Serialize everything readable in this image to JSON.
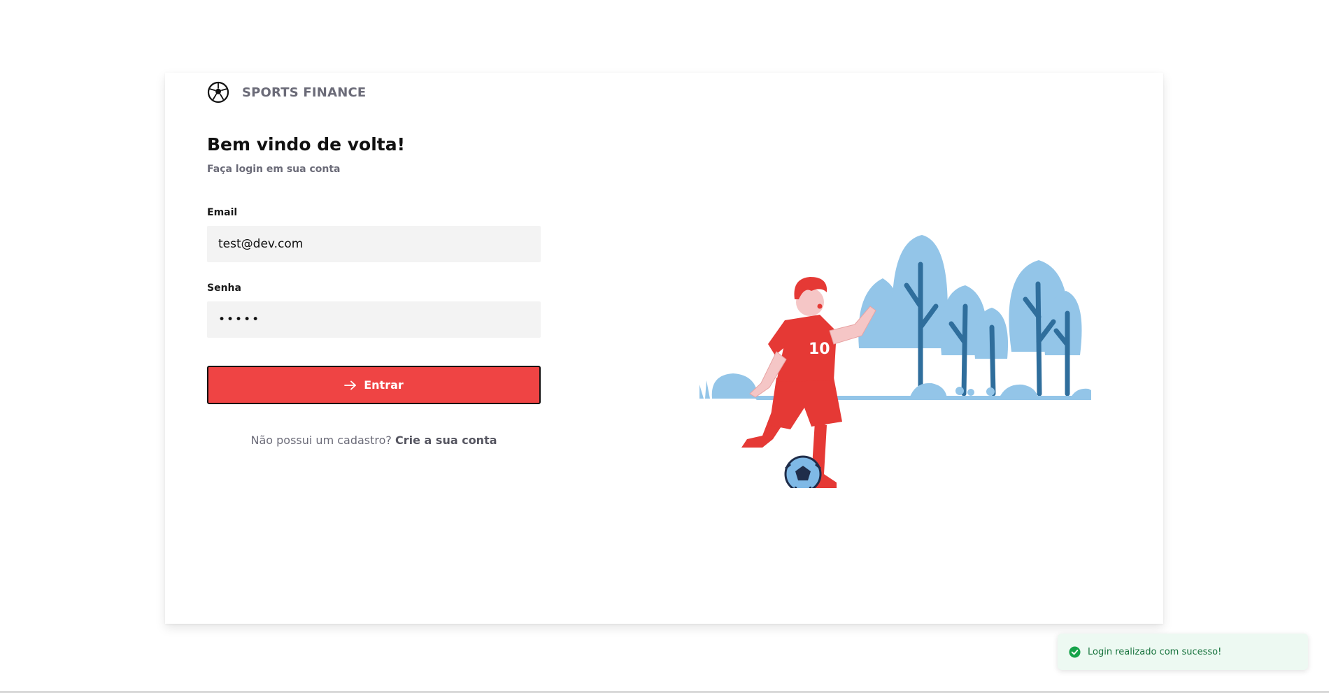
{
  "brand": {
    "name": "SPORTS FINANCE",
    "logo_icon": "soccer-ball-icon"
  },
  "login": {
    "title": "Bem vindo de volta!",
    "subtitle": "Faça login em sua conta",
    "email_label": "Email",
    "email_value": "test@dev.com",
    "password_label": "Senha",
    "password_value": "•••••",
    "submit_label": "Entrar",
    "submit_icon": "arrow-right-icon",
    "signup_prompt": "Não possui um cadastro?",
    "signup_link": "Crie a sua conta"
  },
  "toast": {
    "message": "Login realizado com sucesso!",
    "icon": "check-circle-icon",
    "status_color": "#16a34a"
  },
  "theme": {
    "accent": "#ef4444",
    "muted_text": "#6b6b78",
    "input_bg": "#f3f3f3",
    "tree_color": "#93c5e8",
    "trunk_color": "#2f6e9c"
  }
}
